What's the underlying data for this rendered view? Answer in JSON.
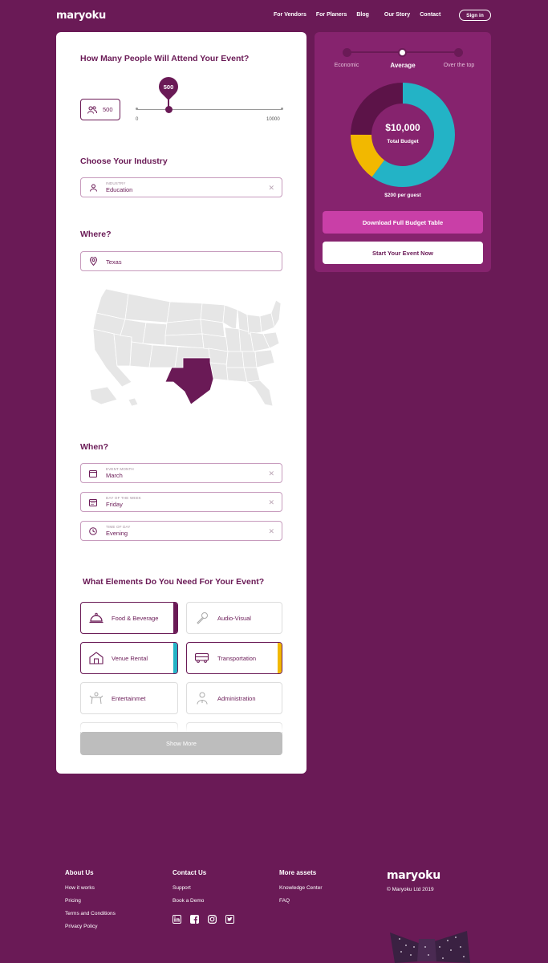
{
  "header": {
    "logo": "maryoku",
    "nav": [
      "For Vendors",
      "For Planers",
      "Blog",
      "Our Story",
      "Contact"
    ],
    "signin": "Sign in"
  },
  "guests": {
    "title": "How Many People Will Attend Your Event?",
    "value": "500",
    "slider_label": "500",
    "min_label": "0",
    "max_label": "10000",
    "slider_fraction": 0.05
  },
  "industry": {
    "title": "Choose Your Industry",
    "label": "INDUSTRY",
    "value": "Education"
  },
  "where": {
    "title": "Where?",
    "value": "Texas"
  },
  "when": {
    "title": "When?",
    "fields": [
      {
        "label": "EVENT MONTH",
        "value": "March"
      },
      {
        "label": "DAY OF THE WEEK",
        "value": "Friday"
      },
      {
        "label": "TIME OF DAY",
        "value": "Evening"
      }
    ]
  },
  "elements": {
    "title": "What Elements Do You Need For Your Event?",
    "items": [
      {
        "label": "Food & Beverage",
        "icon": "food-cloche-icon",
        "selected": true,
        "color": "#6a1a56"
      },
      {
        "label": "Audio-Visual",
        "icon": "microphone-icon",
        "selected": false,
        "color": ""
      },
      {
        "label": "Venue Rental",
        "icon": "venue-icon",
        "selected": true,
        "color": "#23b3c6"
      },
      {
        "label": "Transportation",
        "icon": "bus-icon",
        "selected": true,
        "color": "#f2b800"
      },
      {
        "label": "Entertainmet",
        "icon": "entertainer-icon",
        "selected": false,
        "color": ""
      },
      {
        "label": "Administration",
        "icon": "admin-person-icon",
        "selected": false,
        "color": ""
      }
    ],
    "show_more": "Show More"
  },
  "budget": {
    "levels": [
      "Economic",
      "Average",
      "Over the top"
    ],
    "active_level": 1,
    "total": "$10,000",
    "total_label": "Total Budget",
    "per_guest": "$200 per guest",
    "download": "Download Full Budget Table",
    "start": "Start Your Event Now",
    "chart_data": {
      "type": "pie",
      "slices": [
        {
          "value": 60,
          "color": "#23b3c6"
        },
        {
          "value": 15,
          "color": "#f2b800"
        },
        {
          "value": 25,
          "color": "#5c1348"
        }
      ]
    }
  },
  "footer": {
    "about": {
      "title": "About Us",
      "links": [
        "How it works",
        "Pricing",
        "Terms and Conditions",
        "Privacy Policy"
      ]
    },
    "contact": {
      "title": "Contact Us",
      "links": [
        "Support",
        "Book a Demo"
      ]
    },
    "assets": {
      "title": "More assets",
      "links": [
        "Knowledge Center",
        "FAQ"
      ]
    },
    "logo": "maryoku",
    "copyright": "© Maryoku Ltd 2019",
    "socials": [
      "linkedin-icon",
      "facebook-icon",
      "instagram-icon",
      "twitter-icon"
    ]
  }
}
